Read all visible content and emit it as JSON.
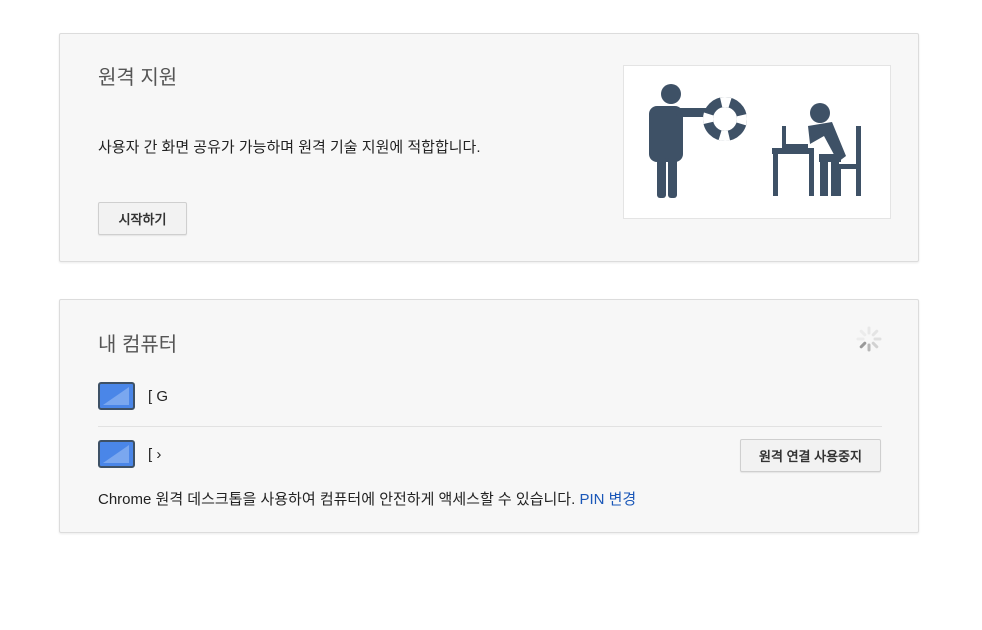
{
  "remote_support": {
    "title": "원격 지원",
    "description": "사용자 간 화면 공유가 가능하며 원격 기술 지원에 적합합니다.",
    "start_label": "시작하기",
    "illustration_icon": "support-lifebuoy-illustration"
  },
  "my_computers": {
    "title": "내 컴퓨터",
    "spinner_icon": "loading-spinner-icon",
    "hosts": [
      {
        "name": "[                              G",
        "icon": "monitor-icon"
      },
      {
        "name": "[                              ›",
        "icon": "monitor-icon"
      }
    ],
    "stop_label": "원격 연결 사용중지",
    "footer_text": "Chrome 원격 데스크톱을 사용하여 컴퓨터에 안전하게 액세스할 수 있습니다. ",
    "change_pin_label": "PIN 변경"
  },
  "colors": {
    "accent_link": "#1a57b8",
    "illustration": "#3e5166",
    "monitor_blue": "#4a86e8"
  }
}
